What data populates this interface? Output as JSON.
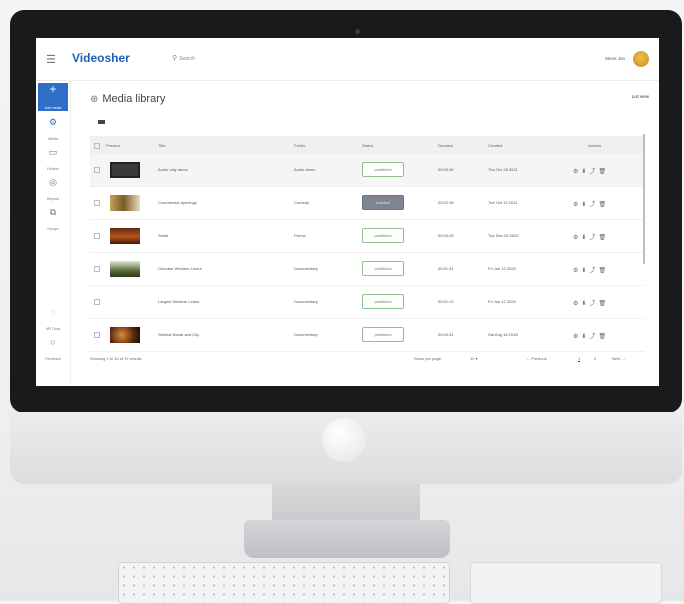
{
  "app": {
    "brand": "Videosher",
    "search_placeholder": "Search",
    "user_name": "Steve Jon"
  },
  "sidebar": {
    "add_label": "Add media",
    "items": [
      {
        "label": "Media",
        "icon": "gear-icon"
      },
      {
        "label": "Folders",
        "icon": "folder-icon"
      },
      {
        "label": "Reports",
        "icon": "chart-icon"
      },
      {
        "label": "Groups",
        "icon": "copy-icon"
      },
      {
        "label": "API Docs",
        "icon": "code-icon"
      },
      {
        "label": "Feedback",
        "icon": "help-icon"
      }
    ]
  },
  "page": {
    "title": "Media library",
    "list_view_label": "List view"
  },
  "table": {
    "columns": [
      "Preview",
      "Title",
      "Folder",
      "Status",
      "Duration",
      "Created",
      "Actions"
    ],
    "rows": [
      {
        "title": "Audio only demo",
        "folder": "Audio demo",
        "status": "published",
        "duration": "00:03:35",
        "created": "Thu Oct 28 2021"
      },
      {
        "title": "Commercial openings",
        "folder": "Comedy",
        "status": "unlisted",
        "duration": "00:02:36",
        "created": "Tue Oct 12 2021"
      },
      {
        "title": "Small",
        "folder": "Promo",
        "status": "published",
        "duration": "00:00:05",
        "created": "Tue Nov 03 2020"
      },
      {
        "title": "Octorber Western Lemur",
        "folder": "Documentary",
        "status": "published",
        "duration": "00:01:31",
        "created": "Fri Jun 12 2020"
      },
      {
        "title": "Largest Western Lemur",
        "folder": "Documentary",
        "status": "published",
        "duration": "00:01:10",
        "created": "Fri Jun 12 2020"
      },
      {
        "title": "Sidebar Break and Clip",
        "folder": "Documentary",
        "status": "published",
        "duration": "00:00:31",
        "created": "Sat Aug 18 2018"
      }
    ]
  },
  "footer": {
    "showing": "Showing 1 to 10 of 37 results",
    "rows_per_page_label": "Rows per page:",
    "rows_per_page_value": "10",
    "previous": "Previous",
    "page_current": "1",
    "page_next": "2",
    "next": "Next"
  },
  "colors": {
    "accent": "#2e6ec9",
    "published_border": "#8fc28f",
    "unlisted_fill": "#7d8592"
  }
}
